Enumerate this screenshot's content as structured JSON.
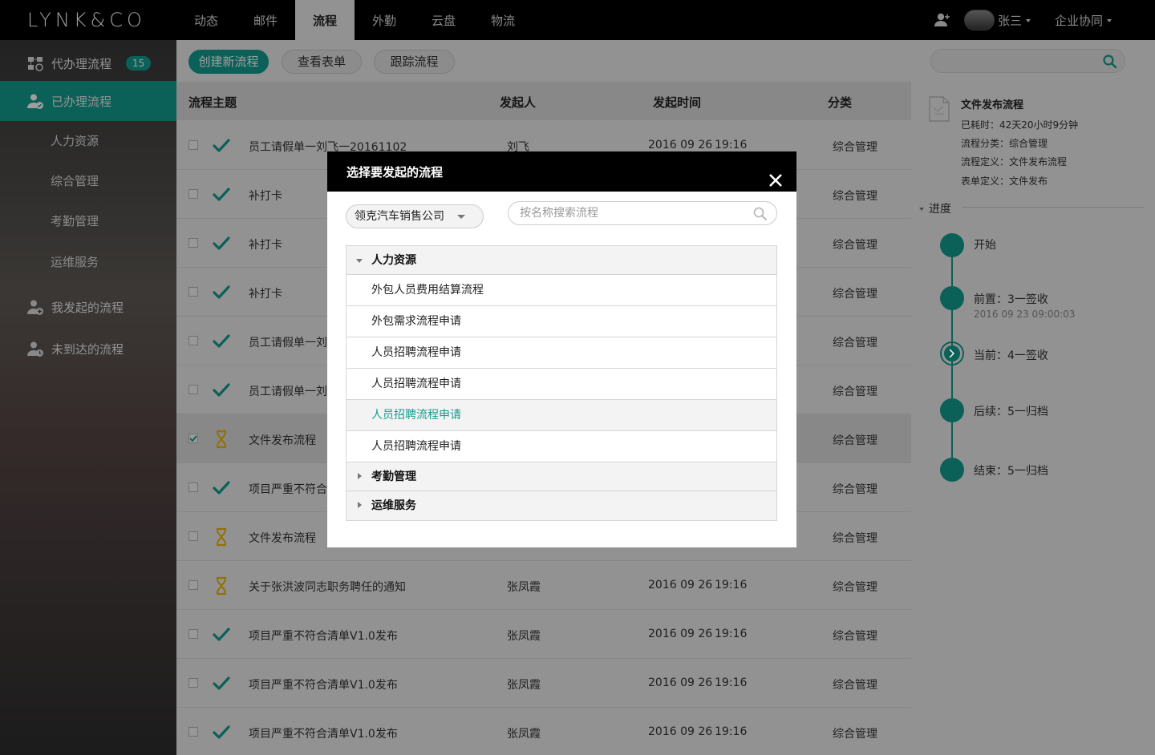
{
  "brand": {
    "logo_text": "LYNK&CO",
    "accent": "#129c8d"
  },
  "topnav": {
    "items": [
      "动态",
      "邮件",
      "流程",
      "外勤",
      "云盘",
      "物流"
    ],
    "active": "流程"
  },
  "user": {
    "name": "张三",
    "collab": "企业协同"
  },
  "sidebar": {
    "items": [
      {
        "label": "代办理流程",
        "badge": "15",
        "icon": "flow-todo-icon"
      },
      {
        "label": "已办理流程",
        "icon": "user-done-icon",
        "active": true
      },
      {
        "label": "我发起的流程",
        "icon": "user-add-icon"
      },
      {
        "label": "未到达的流程",
        "icon": "user-clock-icon"
      }
    ],
    "sub_items": [
      "人力资源",
      "综合管理",
      "考勤管理",
      "运维服务"
    ]
  },
  "toolbar": {
    "create": "创建新流程",
    "view_form": "查看表单",
    "track": "跟踪流程"
  },
  "table": {
    "headers": {
      "subject": "流程主题",
      "initiator": "发起人",
      "time": "发起时间",
      "category": "分类"
    },
    "rows": [
      {
        "subject": "员工请假单一刘飞一20161102",
        "initiator": "刘飞",
        "date": "2016 09 26",
        "time": "19:16",
        "category": "综合管理",
        "status": "check"
      },
      {
        "subject": "补打卡",
        "initiator": "",
        "date": "",
        "time": "",
        "category": "综合管理",
        "status": "check"
      },
      {
        "subject": "补打卡",
        "initiator": "",
        "date": "",
        "time": "",
        "category": "综合管理",
        "status": "check"
      },
      {
        "subject": "补打卡",
        "initiator": "",
        "date": "",
        "time": "",
        "category": "综合管理",
        "status": "check"
      },
      {
        "subject": "员工请假单一刘",
        "initiator": "",
        "date": "",
        "time": "",
        "category": "综合管理",
        "status": "check"
      },
      {
        "subject": "员工请假单一刘",
        "initiator": "",
        "date": "",
        "time": "",
        "category": "综合管理",
        "status": "check"
      },
      {
        "subject": "文件发布流程",
        "initiator": "",
        "date": "",
        "time": "",
        "category": "综合管理",
        "status": "hourglass",
        "selected": true
      },
      {
        "subject": "项目严重不符合",
        "initiator": "",
        "date": "",
        "time": "",
        "category": "综合管理",
        "status": "check"
      },
      {
        "subject": "文件发布流程",
        "initiator": "",
        "date": "",
        "time": "",
        "category": "综合管理",
        "status": "hourglass"
      },
      {
        "subject": "关于张洪波同志职务聘任的通知",
        "initiator": "张凤霞",
        "date": "2016 09 26",
        "time": "19:16",
        "category": "综合管理",
        "status": "hourglass"
      },
      {
        "subject": "项目严重不符合清单V1.0发布",
        "initiator": "张凤霞",
        "date": "2016 09 26",
        "time": "19:16",
        "category": "综合管理",
        "status": "check"
      },
      {
        "subject": "项目严重不符合清单V1.0发布",
        "initiator": "张凤霞",
        "date": "2016 09 26",
        "time": "19:16",
        "category": "综合管理",
        "status": "check"
      },
      {
        "subject": "项目严重不符合清单V1.0发布",
        "initiator": "张凤霞",
        "date": "2016 09 26",
        "time": "19:16",
        "category": "综合管理",
        "status": "check"
      }
    ]
  },
  "detail": {
    "title": "文件发布流程",
    "elapsed": "已耗时：42天20小时9分钟",
    "category": "流程分类：综合管理",
    "definition": "流程定义：文件发布流程",
    "form": "表单定义：文件发布",
    "progress_label": "进度",
    "steps": [
      {
        "label": "开始",
        "time": ""
      },
      {
        "label": "前置：3一签收",
        "time": "2016 09 23   09:00:03"
      },
      {
        "label": "当前：4一签收",
        "time": "",
        "current": true
      },
      {
        "label": "后续：5一归档",
        "time": ""
      },
      {
        "label": "结束：5一归档",
        "time": ""
      }
    ]
  },
  "modal": {
    "title": "选择要发起的流程",
    "company": "领克汽车销售公司",
    "search_placeholder": "按名称搜索流程",
    "groups": [
      {
        "label": "人力资源",
        "expanded": true,
        "items": [
          "外包人员费用结算流程",
          "外包需求流程申请",
          "人员招聘流程申请",
          "人员招聘流程申请",
          "人员招聘流程申请",
          "人员招聘流程申请"
        ],
        "highlight_index": 4
      },
      {
        "label": "考勤管理",
        "expanded": false,
        "items": []
      },
      {
        "label": "运维服务",
        "expanded": false,
        "items": []
      }
    ]
  }
}
